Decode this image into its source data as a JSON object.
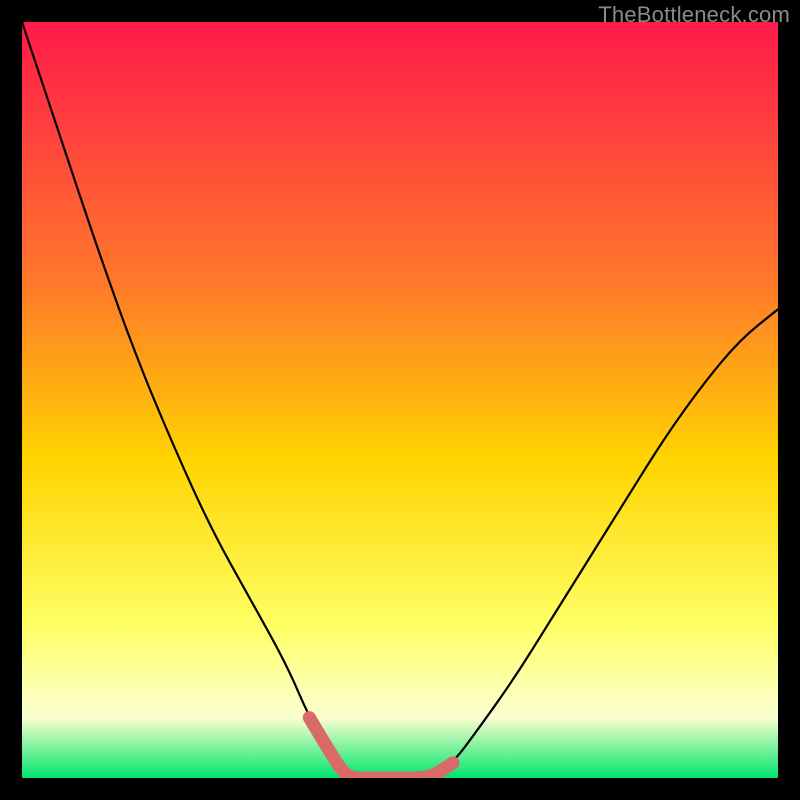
{
  "watermark": "TheBottleneck.com",
  "colors": {
    "gradient_top": "#ff1a4b",
    "gradient_mid_upper": "#ff7a2a",
    "gradient_mid": "#ffd400",
    "gradient_lower": "#ffff66",
    "gradient_pale": "#fbffd0",
    "gradient_bottom": "#00e56b",
    "curve": "#000000",
    "highlight": "#d86a6a",
    "frame_bg": "#000000"
  },
  "chart_data": {
    "type": "line",
    "title": "",
    "xlabel": "",
    "ylabel": "",
    "xlim": [
      0,
      100
    ],
    "ylim": [
      0,
      100
    ],
    "grid": false,
    "legend": false,
    "series": [
      {
        "name": "bottleneck_curve",
        "x": [
          0,
          5,
          10,
          15,
          20,
          25,
          30,
          35,
          38,
          41,
          43,
          46,
          50,
          54,
          57,
          60,
          65,
          70,
          75,
          80,
          85,
          90,
          95,
          100
        ],
        "values": [
          100,
          85,
          70,
          56,
          44,
          33,
          24,
          15,
          8,
          3,
          0,
          0,
          0,
          0,
          2,
          6,
          13,
          21,
          29,
          37,
          45,
          52,
          58,
          62
        ]
      }
    ],
    "highlight_region": {
      "x": [
        38,
        41,
        43,
        46,
        50,
        54,
        57
      ],
      "values": [
        8,
        3,
        0,
        0,
        0,
        0,
        2
      ]
    }
  }
}
